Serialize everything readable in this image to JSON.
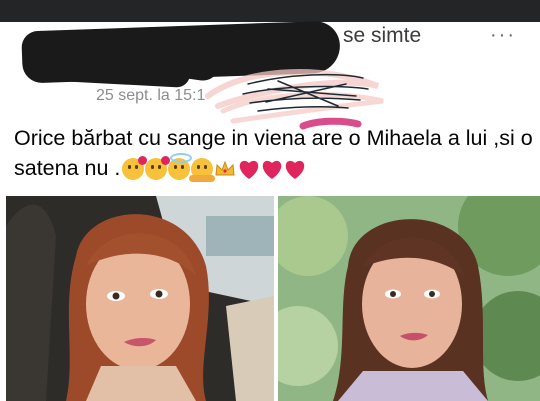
{
  "post": {
    "status_suffix": "se simte",
    "more_label": "···",
    "timestamp": "25 sept. la 15:1",
    "text": "Orice  bărbat cu sange in viena are o Mihaela a lui ,si o satena nu .",
    "emojis": [
      "kissing-face",
      "kissing-face",
      "smiling-face-with-halo",
      "hugging-face",
      "crown",
      "red-heart",
      "red-heart",
      "red-heart"
    ]
  },
  "photos": [
    {
      "alt": "photo-1"
    },
    {
      "alt": "photo-2"
    }
  ],
  "colors": {
    "topbar": "#242526",
    "text": "#050505",
    "muted": "#8a8d91",
    "heart": "#e0245e",
    "redaction": "#1a1a1a"
  }
}
